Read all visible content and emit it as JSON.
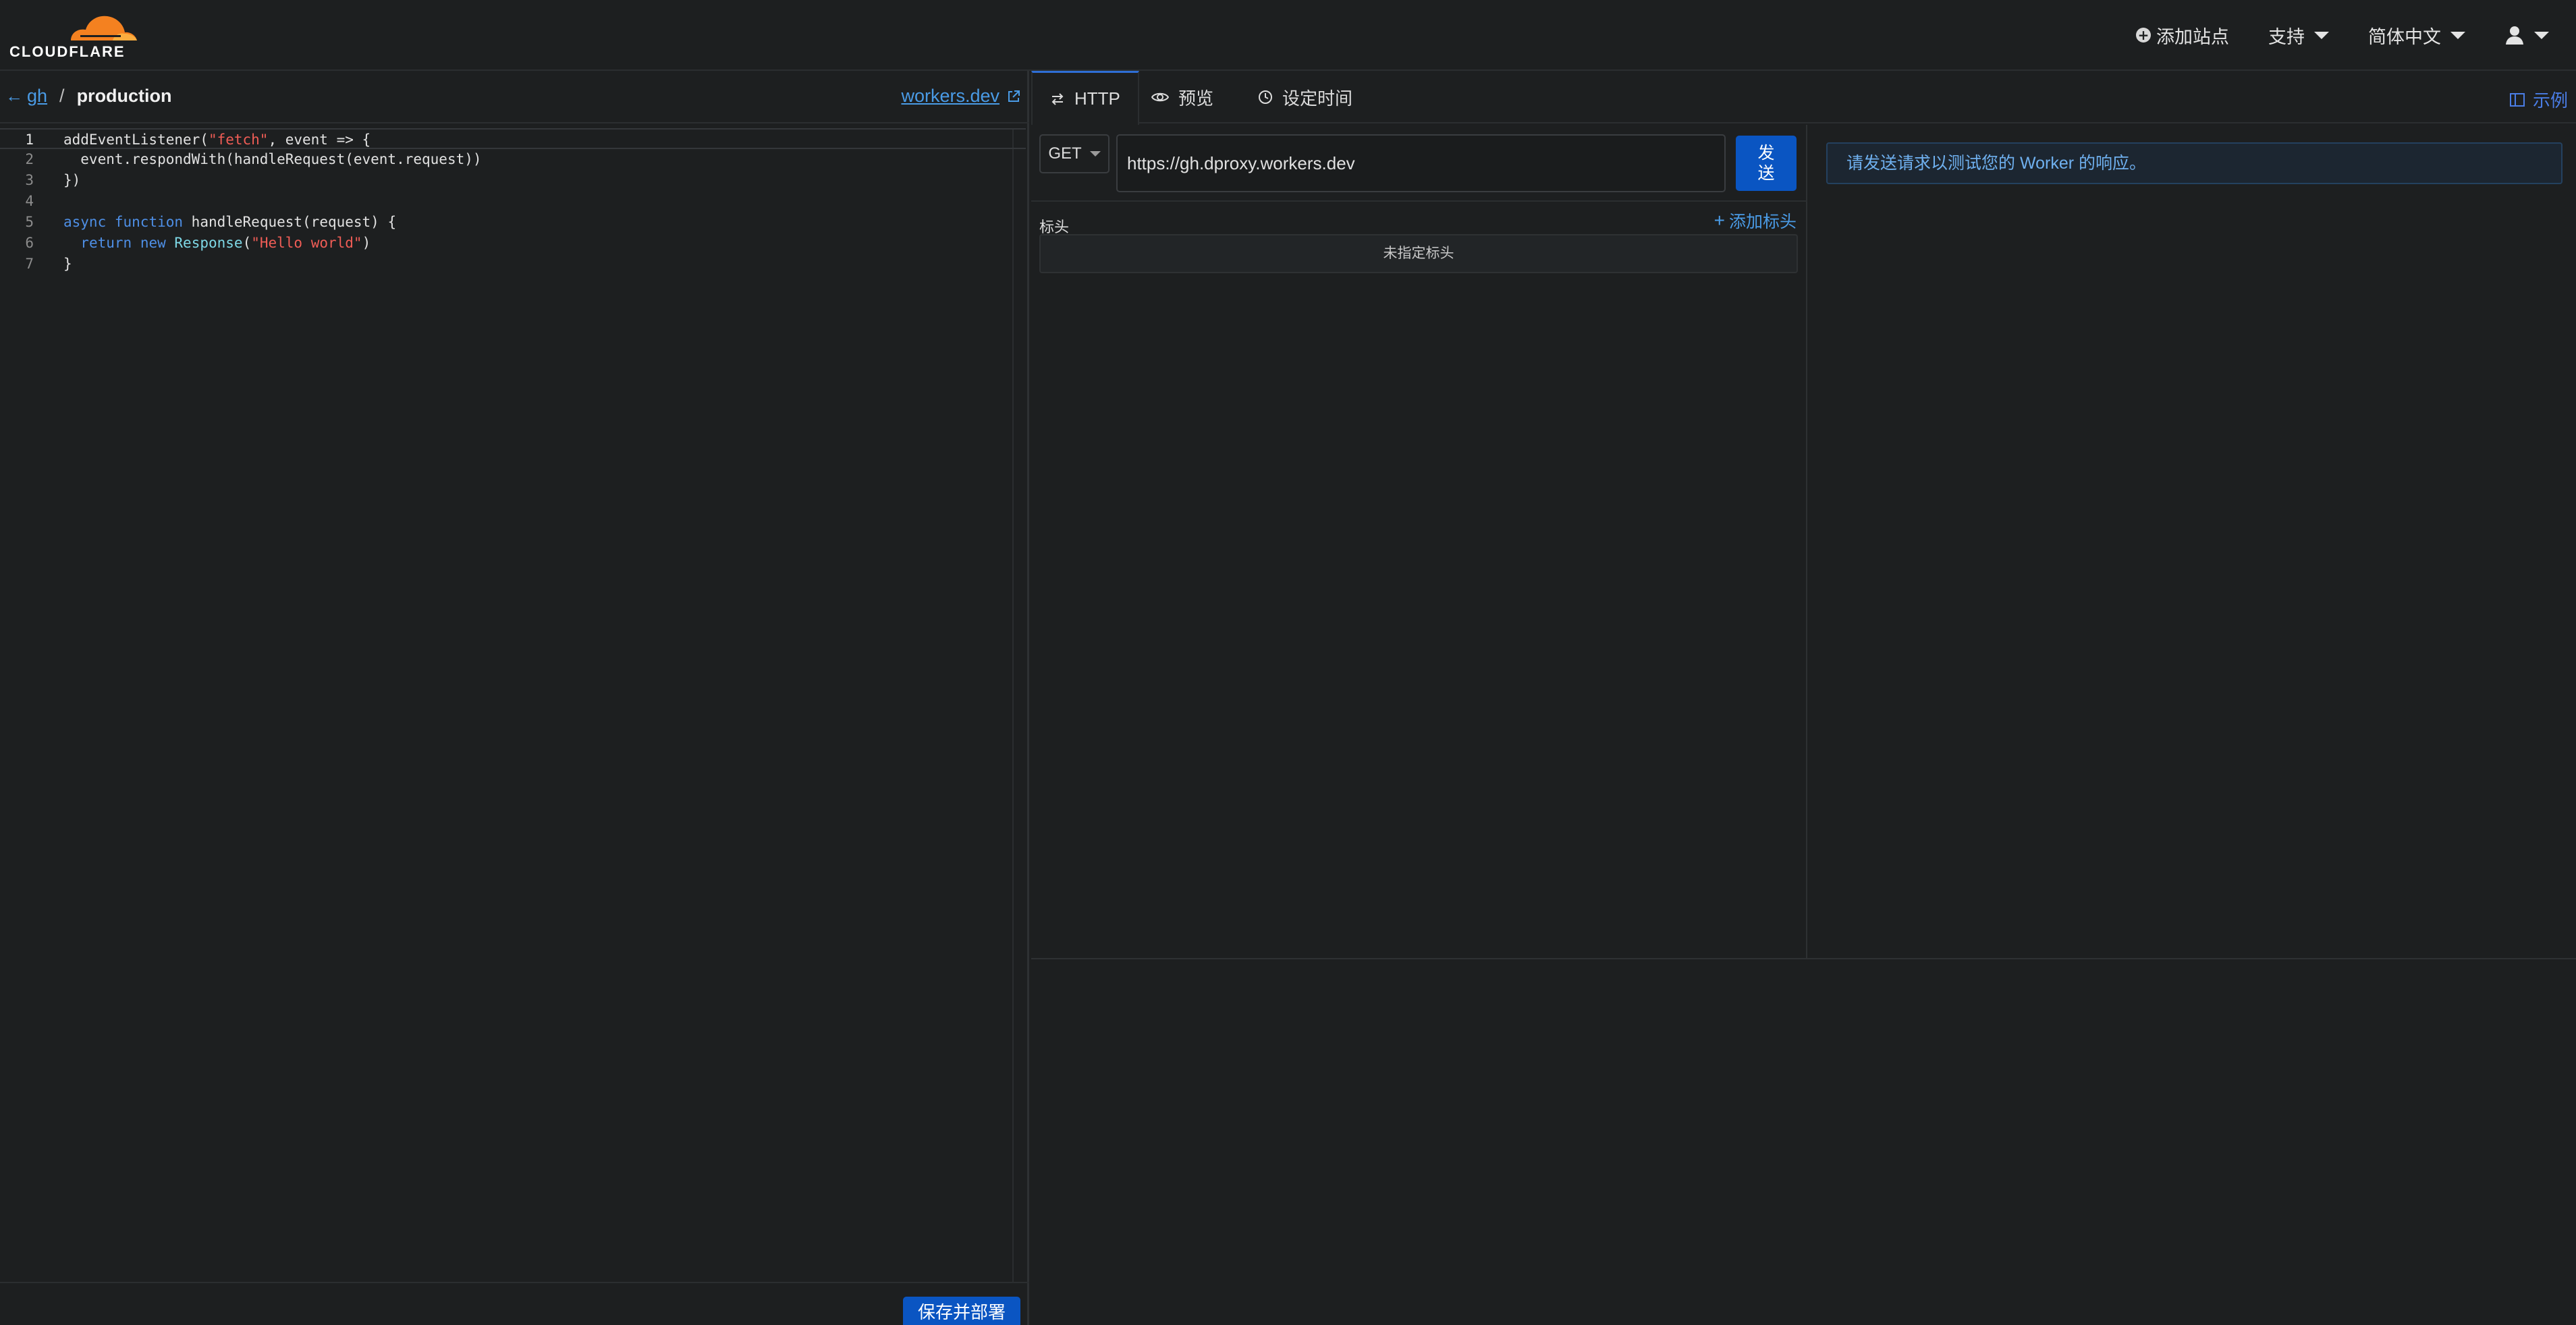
{
  "brand": {
    "logo_text": "CLOUDFLARE",
    "orange": "#f48120",
    "light_orange": "#faad3f"
  },
  "topnav": {
    "add_site": "添加站点",
    "support": "支持",
    "language": "简体中文"
  },
  "editor": {
    "breadcrumb": {
      "parent": "gh",
      "separator": "/",
      "current": "production"
    },
    "workers_link": "workers.dev",
    "code": [
      {
        "n": "1",
        "parts": [
          [
            "",
            "addEventListener("
          ],
          [
            "str",
            "\"fetch\""
          ],
          [
            "",
            ", event => {"
          ]
        ]
      },
      {
        "n": "2",
        "parts": [
          [
            "",
            "  event.respondWith(handleRequest(event.request))"
          ]
        ]
      },
      {
        "n": "3",
        "parts": [
          [
            "",
            "})"
          ]
        ]
      },
      {
        "n": "4",
        "parts": [
          [
            "",
            ""
          ]
        ]
      },
      {
        "n": "5",
        "parts": [
          [
            "kw",
            "async"
          ],
          [
            "",
            " "
          ],
          [
            "kw",
            "function"
          ],
          [
            "",
            " handleRequest(request) {"
          ]
        ]
      },
      {
        "n": "6",
        "parts": [
          [
            "",
            "  "
          ],
          [
            "kw",
            "return"
          ],
          [
            "",
            " "
          ],
          [
            "kw",
            "new"
          ],
          [
            "",
            " "
          ],
          [
            "cls",
            "Response"
          ],
          [
            "",
            "("
          ],
          [
            "str",
            "\"Hello world\""
          ],
          [
            "",
            ")"
          ]
        ]
      },
      {
        "n": "7",
        "parts": [
          [
            "",
            "}"
          ]
        ]
      }
    ],
    "save_label": "保存并部署"
  },
  "preview": {
    "tabs": [
      {
        "label": "HTTP",
        "icon": "swap-arrows-icon",
        "active": true
      },
      {
        "label": "预览",
        "icon": "eye-icon",
        "active": false
      },
      {
        "label": "设定时间",
        "icon": "clock-icon",
        "active": false
      }
    ],
    "examples_label": "示例",
    "request": {
      "method": "GET",
      "url": "https://gh.dproxy.workers.dev",
      "send_label": "发送",
      "headers_label": "标头",
      "add_header_label": "添加标头",
      "no_headers_text": "未指定标头"
    },
    "response": {
      "notice": "请发送请求以测试您的 Worker 的响应。"
    }
  },
  "colors": {
    "accent": "#0a55c2",
    "link": "#4a9be6",
    "background": "#1d1f20"
  }
}
